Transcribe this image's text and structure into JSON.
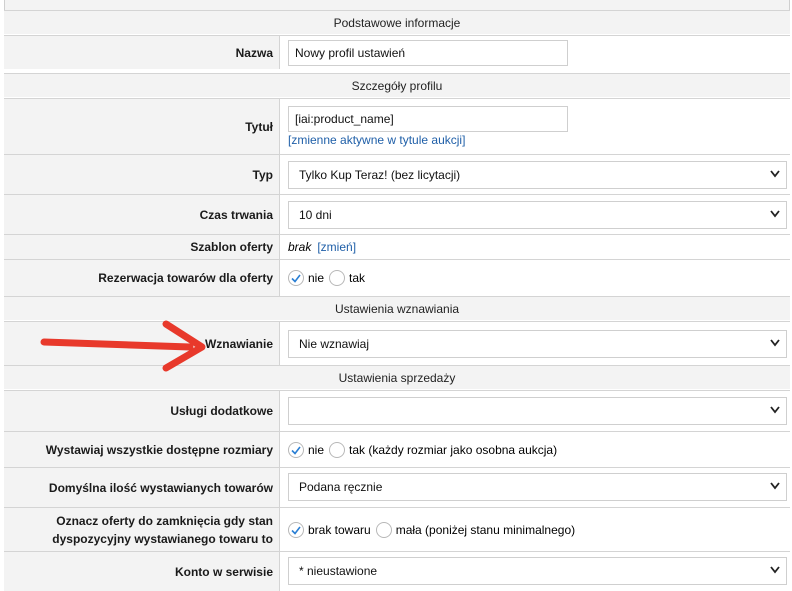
{
  "sections": {
    "basic": "Podstawowe informacje",
    "profile": "Szczegóły profilu",
    "renewal": "Ustawienia wznawiania",
    "sale": "Ustawienia sprzedaży"
  },
  "fields": {
    "name": {
      "label": "Nazwa",
      "value": "Nowy profil ustawień"
    },
    "title": {
      "label": "Tytuł",
      "value": "[iai:product_name]",
      "link": "[zmienne aktywne w tytule aukcji]"
    },
    "type": {
      "label": "Typ",
      "value": "Tylko Kup Teraz! (bez licytacji)"
    },
    "duration": {
      "label": "Czas trwania",
      "value": "10 dni"
    },
    "template": {
      "label": "Szablon oferty",
      "value": "brak",
      "link": "[zmień]"
    },
    "reservation": {
      "label": "Rezerwacja towarów dla oferty",
      "opt_no": "nie",
      "opt_yes": "tak",
      "selected": "nie"
    },
    "renewal": {
      "label": "Wznawianie",
      "value": "Nie wznawiaj"
    },
    "extra_services": {
      "label": "Usługi dodatkowe",
      "value": ""
    },
    "all_sizes": {
      "label": "Wystawiaj wszystkie dostępne rozmiary",
      "opt_no": "nie",
      "opt_yes": "tak (każdy rozmiar jako osobna aukcja)",
      "selected": "nie"
    },
    "default_qty": {
      "label": "Domyślna ilość wystawianych towarów",
      "value": "Podana ręcznie"
    },
    "close_offers": {
      "label_line1": "Oznacz oferty do zamknięcia gdy stan",
      "label_line2": "dyspozycyjny wystawianego towaru to",
      "opt_1": "brak towaru",
      "opt_2": "mała (poniżej stanu minimalnego)",
      "selected": "brak towaru"
    },
    "account": {
      "label": "Konto w serwisie",
      "value": "* nieustawione"
    }
  },
  "colors": {
    "accent_arrow": "#e8392b",
    "link": "#1f5fa8",
    "check": "#2a7fd4"
  }
}
